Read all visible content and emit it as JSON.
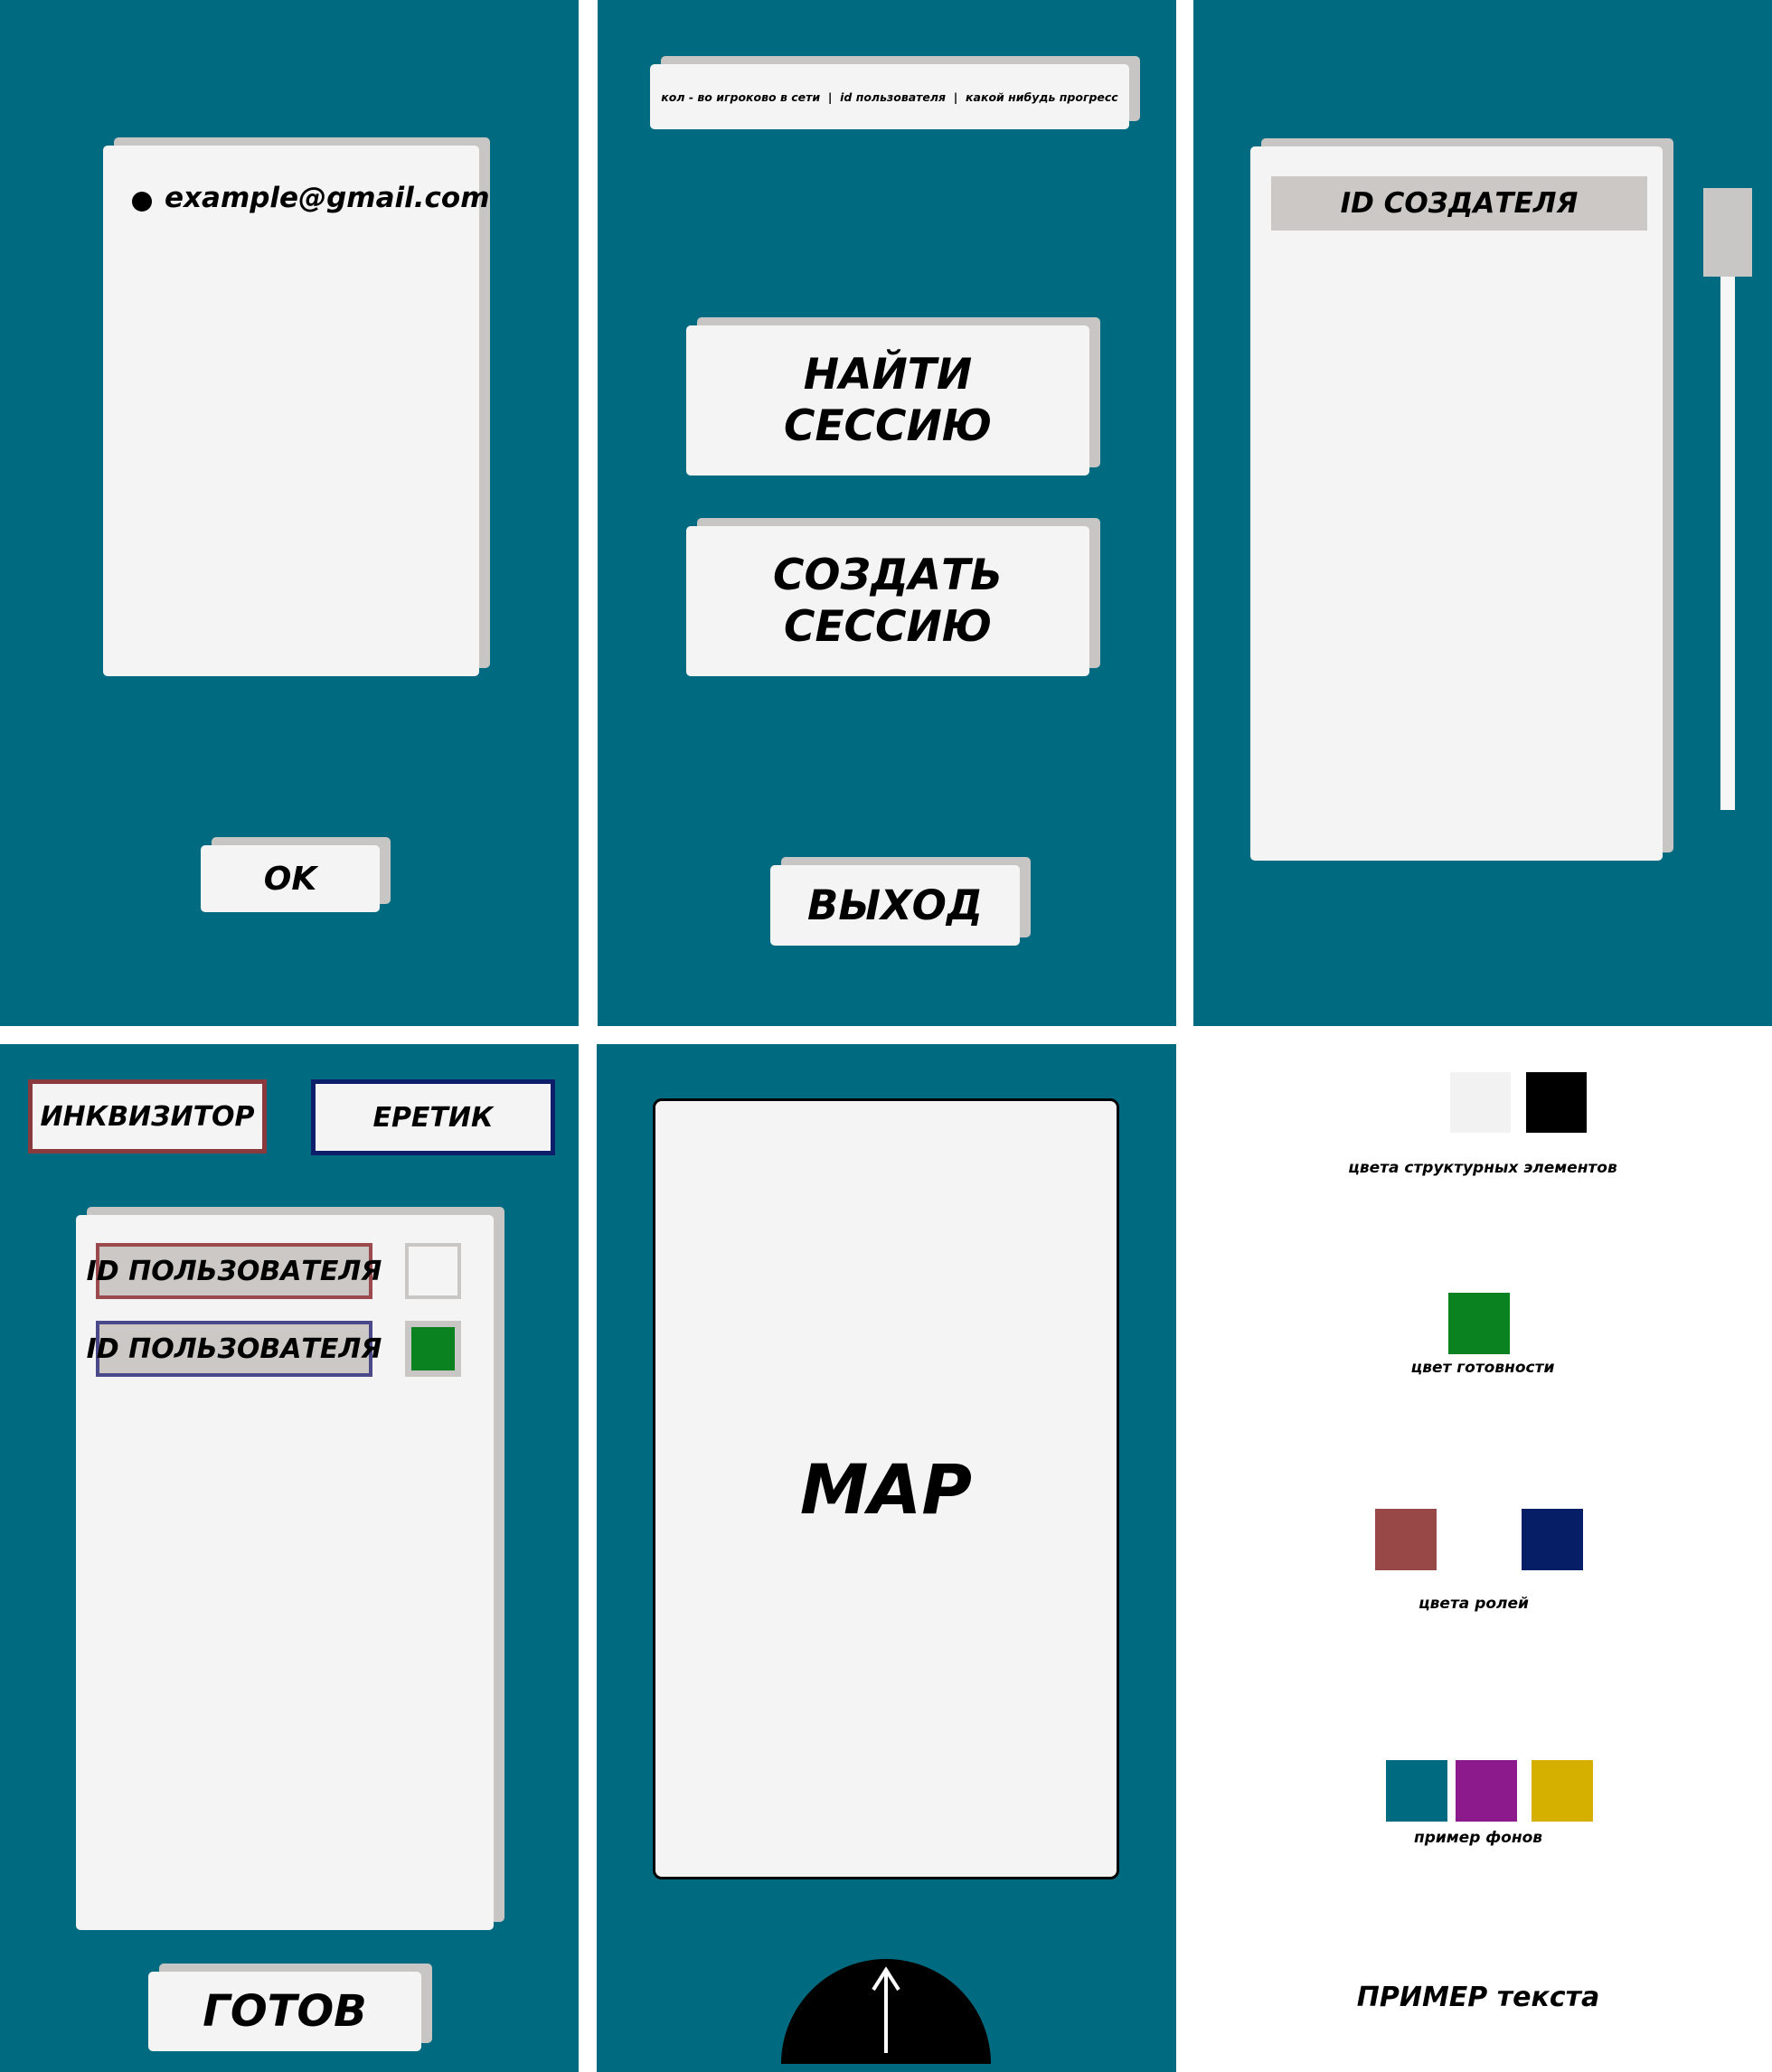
{
  "screen_login": {
    "email": "example@gmail.com",
    "ok_label": "OK"
  },
  "screen_menu": {
    "status_bar": "кол - во игроково в сети  |  id пользователя  |  какой нибудь прогресс",
    "find_session_line1": "НАЙТИ",
    "find_session_line2": "СЕССИЮ",
    "create_session_line1": "СОЗДАТЬ",
    "create_session_line2": "СЕССИЮ",
    "exit_label": "ВЫХОД"
  },
  "screen_sessions": {
    "items": [
      {
        "label": "ID СОЗДАТЕЛЯ"
      }
    ]
  },
  "screen_lobby": {
    "roles": [
      {
        "label": "ИНКВИЗИТОР",
        "color": "#8a3a3d"
      },
      {
        "label": "ЕРЕТИК",
        "color": "#0d1f6b"
      }
    ],
    "players": [
      {
        "label": "ID ПОЛЬЗОВАТЕЛЯ",
        "ready": false,
        "role_color": "#9a4a4c"
      },
      {
        "label": "ID ПОЛЬЗОВАТЕЛЯ",
        "ready": true,
        "role_color": "#4a4a8a"
      }
    ],
    "ready_label": "ГОТОВ"
  },
  "screen_map": {
    "map_label": "MAP"
  },
  "palette": {
    "structural_colors": [
      "#f2f2f2",
      "#000000"
    ],
    "structural_caption": "цвета структурных элементов",
    "ready_color": "#0a8220",
    "ready_caption": "цвет готовности",
    "role_colors": [
      "#994848",
      "#061e66"
    ],
    "role_caption": "цвета ролей",
    "background_colors": [
      "#006b80",
      "#8c1a8c",
      "#d6b000"
    ],
    "background_caption": "пример фонов",
    "text_sample": "ПРИМЕР текста"
  },
  "colors": {
    "screen_bg": "#006b80",
    "panel": "#f4f4f4",
    "panel_shadow": "#c8c6c4"
  }
}
